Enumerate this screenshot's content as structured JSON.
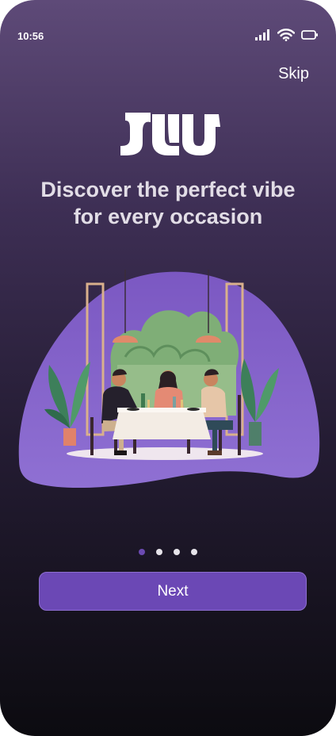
{
  "status_bar": {
    "time": "10:56",
    "icons": [
      "signal-icon",
      "wifi-icon",
      "battery-icon"
    ]
  },
  "header": {
    "skip_label": "Skip"
  },
  "brand": {
    "logo_text": "JAW"
  },
  "onboarding": {
    "headline_line1": "Discover the perfect vibe",
    "headline_line2": "for every occasion",
    "illustration": "dining-scene-illustration",
    "page_indicator": {
      "total": 4,
      "active_index": 0
    }
  },
  "actions": {
    "next_label": "Next"
  },
  "colors": {
    "accent": "#6b48b5",
    "blob": "#7e5cc4",
    "dot_active": "#6b4ab1",
    "dot_inactive": "#e6e4ea"
  }
}
